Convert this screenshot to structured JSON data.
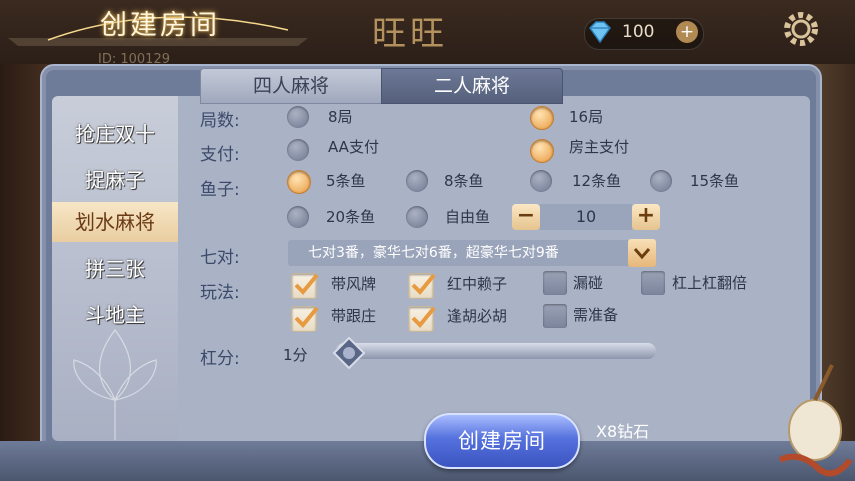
{
  "header": {
    "dialog_title": "创建房间",
    "lobby_title": "旺旺",
    "user_id": "ID: 100129",
    "diamonds": "100",
    "plus_label": "+"
  },
  "tabs": [
    {
      "label": "四人麻将",
      "active": false
    },
    {
      "label": "二人麻将",
      "active": true
    }
  ],
  "sidebar": {
    "items": [
      {
        "label": "抢庄双十",
        "active": false
      },
      {
        "label": "捉麻子",
        "active": false
      },
      {
        "label": "划水麻将",
        "active": true
      },
      {
        "label": "拼三张",
        "active": false
      },
      {
        "label": "斗地主",
        "active": false
      }
    ]
  },
  "form": {
    "rounds": {
      "label": "局数:",
      "options": [
        {
          "text": "8局",
          "selected": false
        },
        {
          "text": "16局",
          "selected": true
        }
      ]
    },
    "payment": {
      "label": "支付:",
      "options": [
        {
          "text": "AA支付",
          "selected": false
        },
        {
          "text": "房主支付",
          "selected": true
        }
      ]
    },
    "fish": {
      "label": "鱼子:",
      "options": [
        {
          "text": "5条鱼",
          "selected": true
        },
        {
          "text": "8条鱼",
          "selected": false
        },
        {
          "text": "12条鱼",
          "selected": false
        },
        {
          "text": "15条鱼",
          "selected": false
        },
        {
          "text": "20条鱼",
          "selected": false
        },
        {
          "text": "自由鱼",
          "selected": false
        }
      ],
      "stepper_value": "10",
      "minus_label": "−",
      "plus_label": "+"
    },
    "seven_pairs": {
      "label": "七对:",
      "value": "七对3番，豪华七对6番，超豪华七对9番"
    },
    "play": {
      "label": "玩法:",
      "options": [
        {
          "text": "带风牌",
          "checked": true
        },
        {
          "text": "红中赖子",
          "checked": true
        },
        {
          "text": "漏碰",
          "checked": false
        },
        {
          "text": "杠上杠翻倍",
          "checked": false
        },
        {
          "text": "带跟庄",
          "checked": true
        },
        {
          "text": "逢胡必胡",
          "checked": true
        },
        {
          "text": "需准备",
          "checked": false
        }
      ]
    },
    "kong_score": {
      "label": "杠分:",
      "value": "1分",
      "slider_fraction": 0
    }
  },
  "footer": {
    "create_button": "创建房间",
    "cost": "X8钻石"
  },
  "colors": {
    "accent_orange": "#e89a40",
    "button_blue": "#4a64d0",
    "active_sidebar": "#f2dcb4"
  }
}
